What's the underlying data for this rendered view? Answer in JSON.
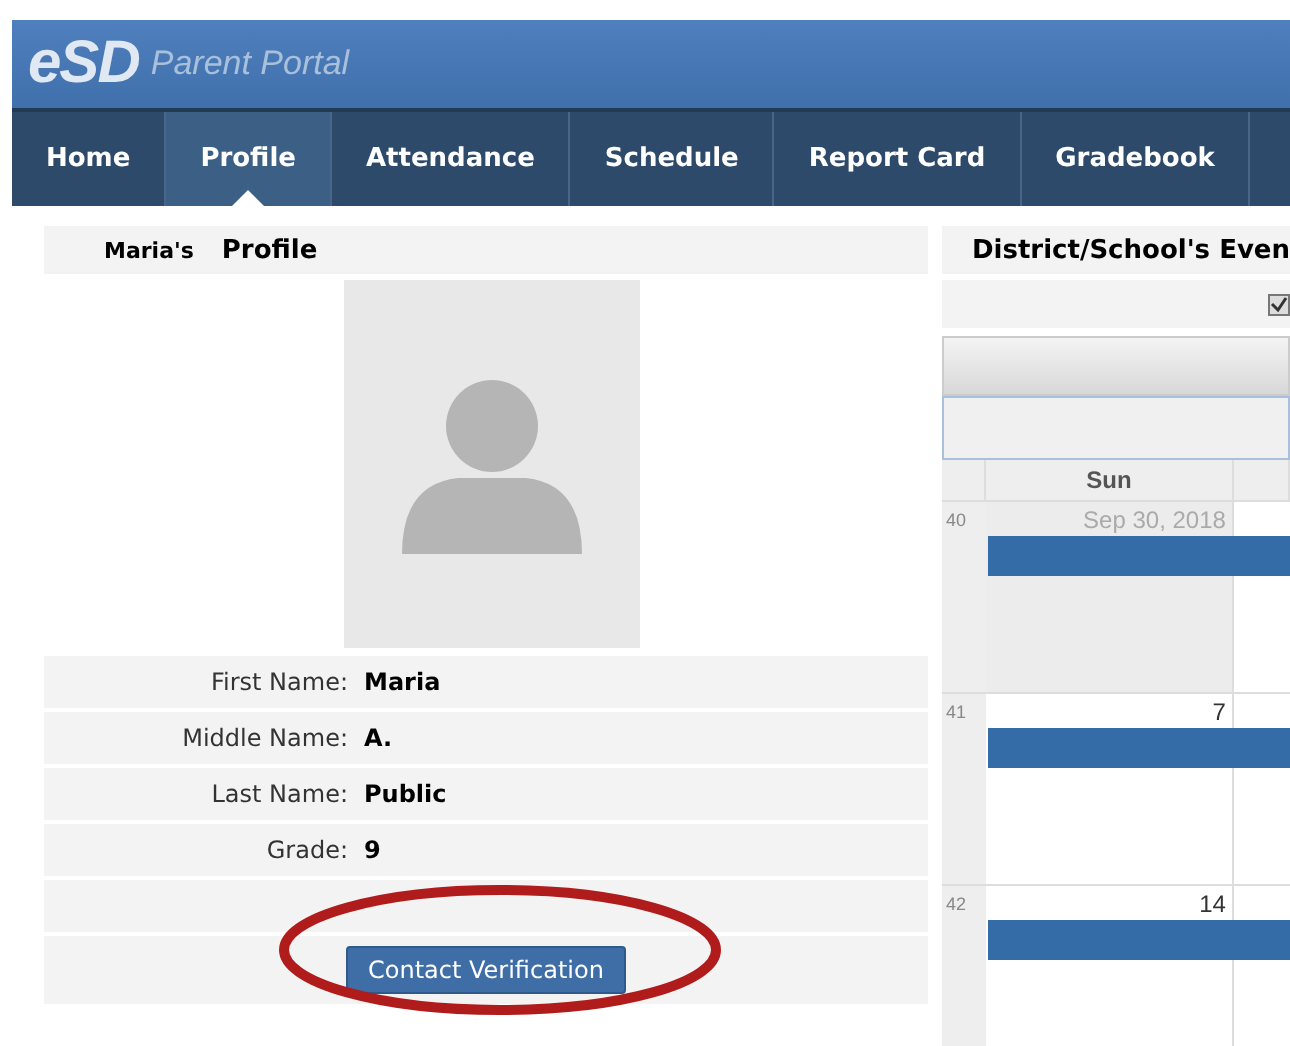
{
  "header": {
    "logo": "eSD",
    "title": "Parent Portal"
  },
  "nav": [
    {
      "label": "Home",
      "selected": false
    },
    {
      "label": "Profile",
      "selected": true
    },
    {
      "label": "Attendance",
      "selected": false
    },
    {
      "label": "Schedule",
      "selected": false
    },
    {
      "label": "Report Card",
      "selected": false
    },
    {
      "label": "Gradebook",
      "selected": false
    }
  ],
  "profile": {
    "owner": "Maria's",
    "title": "Profile",
    "fields": [
      {
        "label": "First Name:",
        "value": "Maria"
      },
      {
        "label": "Middle Name:",
        "value": "A."
      },
      {
        "label": "Last Name:",
        "value": "Public"
      },
      {
        "label": "Grade:",
        "value": "9"
      }
    ],
    "button": "Contact Verification"
  },
  "calendar": {
    "title": "District/School's Even",
    "checkbox": {
      "checked": true
    },
    "day_header": "Sun",
    "weeks": [
      {
        "number": "40",
        "date": "Sep 30, 2018",
        "outside_month": true
      },
      {
        "number": "41",
        "date": "7",
        "outside_month": false
      },
      {
        "number": "42",
        "date": "14",
        "outside_month": false
      }
    ]
  }
}
